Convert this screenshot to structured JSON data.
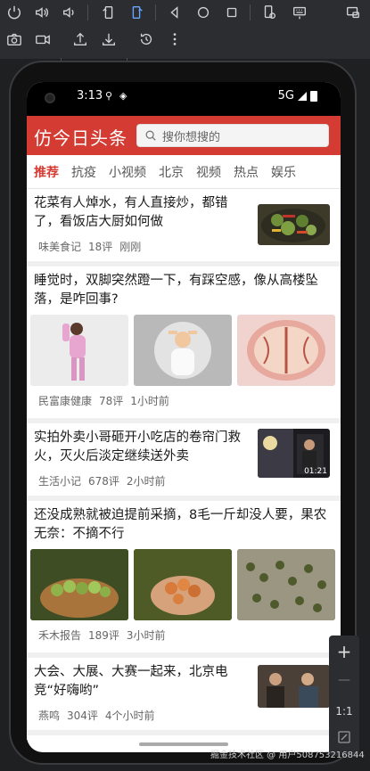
{
  "toolbar": {
    "row1": [
      "power-icon",
      "volume-up-icon",
      "volume-down-icon",
      "rotate-left-icon",
      "rotate-right-icon",
      "back-icon",
      "home-icon",
      "overview-icon",
      "device-settings-icon",
      "keyboard-icon",
      "screen-mirror-icon"
    ],
    "row2": [
      "camera-icon",
      "video-icon",
      "upload-icon",
      "download-icon",
      "restore-icon",
      "more-vertical-icon"
    ]
  },
  "status_bar": {
    "time": "3:13",
    "network": "5G"
  },
  "app": {
    "title": "仿今日头条",
    "search_placeholder": "搜你想搜的",
    "brand_color": "#d33b33"
  },
  "tabs": [
    {
      "label": "推荐",
      "active": true
    },
    {
      "label": "抗疫",
      "active": false
    },
    {
      "label": "小视频",
      "active": false
    },
    {
      "label": "北京",
      "active": false
    },
    {
      "label": "视频",
      "active": false
    },
    {
      "label": "热点",
      "active": false
    },
    {
      "label": "娱乐",
      "active": false
    }
  ],
  "feed": [
    {
      "title": "花菜有人焯水，有人直接炒，都错了，看饭店大厨如何做",
      "source": "味美食记",
      "comments": "18评",
      "time": "刚刚"
    },
    {
      "title": "睡觉时，双脚突然蹬一下，有踩空感，像从高楼坠落，是咋回事?",
      "source": "民富康健康",
      "comments": "78评",
      "time": "1小时前"
    },
    {
      "title": "实拍外卖小哥砸开小吃店的卷帘门救火，灭火后淡定继续送外卖",
      "source": "生活小记",
      "comments": "678评",
      "time": "2小时前",
      "video_duration": "01:21"
    },
    {
      "title": "还没成熟就被迫提前采摘，8毛一斤却没人要，果农无奈：不摘不行",
      "source": "禾木报告",
      "comments": "189评",
      "time": "3小时前"
    },
    {
      "title": "大会、大展、大赛一起来，北京电竞“好嗨哟”",
      "source": "燕鸣",
      "comments": "304评",
      "time": "4个小时前"
    }
  ],
  "side_panel": {
    "zoom_in": "+",
    "zoom_out": "—",
    "ratio": "1:1"
  },
  "watermark": "掘金技术社区 @ 用户508753216844"
}
